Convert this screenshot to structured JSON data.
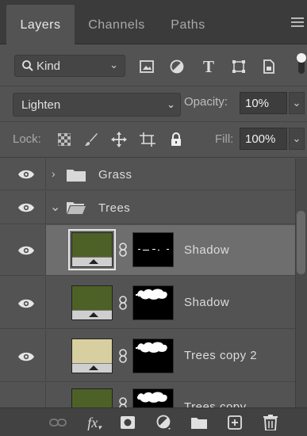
{
  "tabs": [
    {
      "label": "Layers",
      "active": true
    },
    {
      "label": "Channels",
      "active": false
    },
    {
      "label": "Paths",
      "active": false
    }
  ],
  "filter": {
    "kind_label": "Kind",
    "icons": [
      "pixel-filter-icon",
      "adjustment-filter-icon",
      "type-filter-icon",
      "shape-filter-icon",
      "smart-object-filter-icon",
      "filter-toggle-icon"
    ]
  },
  "blend": {
    "mode": "Lighten",
    "opacity_label": "Opacity:",
    "opacity_value": "10%"
  },
  "lock": {
    "label": "Lock:",
    "icons": [
      "lock-transparent-icon",
      "lock-paint-icon",
      "lock-move-icon",
      "lock-artboard-icon",
      "lock-all-icon"
    ],
    "fill_label": "Fill:",
    "fill_value": "100%"
  },
  "layers": [
    {
      "name": "Grass",
      "type": "group",
      "expanded": false,
      "visible": true
    },
    {
      "name": "Trees",
      "type": "group",
      "expanded": true,
      "visible": true
    },
    {
      "name": "Shadow",
      "type": "layer",
      "visible": true,
      "selected": true,
      "thumb_color": "#4d6127"
    },
    {
      "name": "Shadow",
      "type": "layer",
      "visible": true,
      "selected": false,
      "thumb_color": "#4d6127"
    },
    {
      "name": "Trees copy 2",
      "type": "layer",
      "visible": true,
      "selected": false,
      "thumb_color": "#d8cfa0"
    },
    {
      "name": "Trees copy",
      "type": "layer",
      "visible": true,
      "selected": false,
      "thumb_color": "#4d6127"
    }
  ],
  "bottom_toolbar": [
    "link-layers-icon",
    "fx-icon",
    "add-mask-icon",
    "adjustment-layer-icon",
    "new-group-icon",
    "new-layer-icon",
    "delete-layer-icon"
  ],
  "bottom_fx_label": "fx",
  "colors": {
    "panel_bg": "#535353",
    "selected_row": "#6e6e6e",
    "tab_bar": "#3b3b3b"
  }
}
